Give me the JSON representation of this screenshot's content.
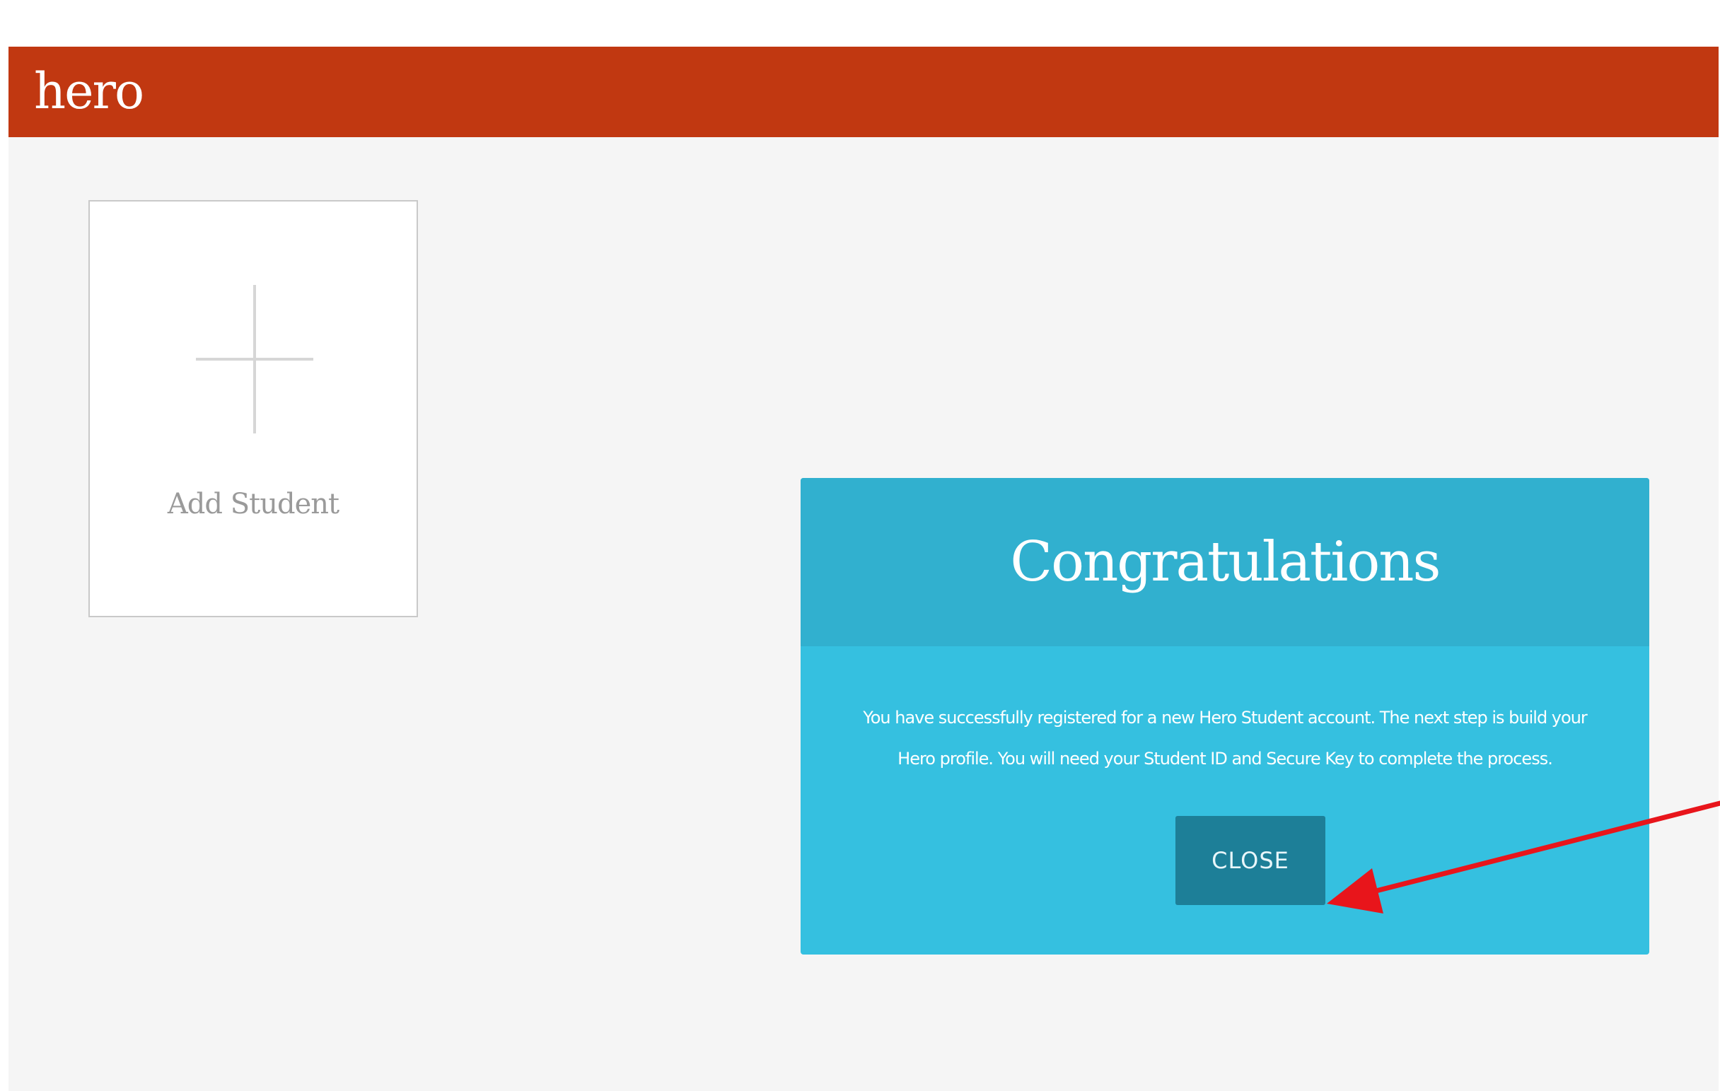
{
  "header": {
    "logo_text": "hero",
    "bar_color": "#c13811"
  },
  "main": {
    "add_student_card": {
      "icon": "plus-icon",
      "label": "Add Student"
    }
  },
  "modal": {
    "title": "Congratulations",
    "message": "You have successfully registered for a new Hero Student account. The next step is build your Hero profile. You will need your Student ID and Secure Key to complete the process.",
    "close_label": "CLOSE",
    "accent_color": "#35c0e0",
    "button_color": "#1d7f98"
  },
  "annotation": {
    "icon": "arrow-icon",
    "color": "#e8151b"
  }
}
